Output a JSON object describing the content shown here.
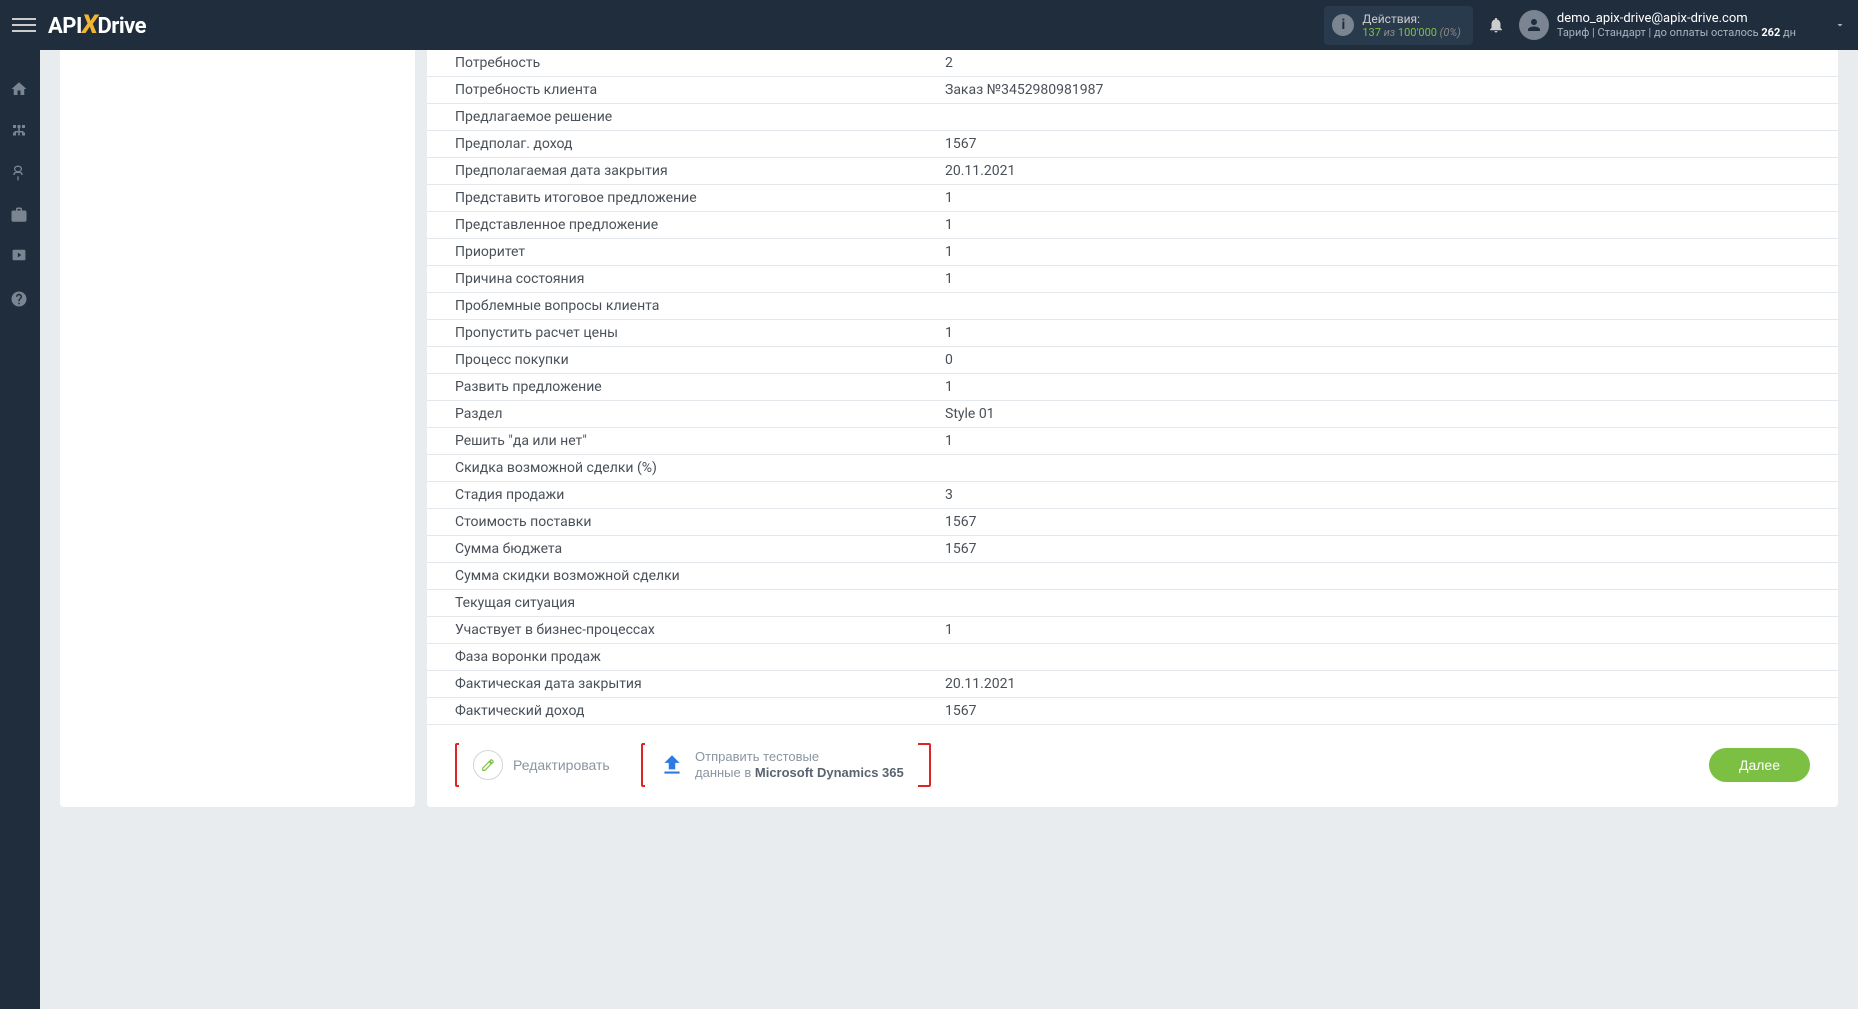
{
  "header": {
    "logo_pre": "API",
    "logo_x": "X",
    "logo_post": "Drive",
    "actions_label": "Действия:",
    "actions_count": "137",
    "actions_of": "из",
    "actions_total": "100'000",
    "actions_pct": "(0%)",
    "user_email": "demo_apix-drive@apix-drive.com",
    "tariff_prefix": "Тариф | Стандарт | до оплаты осталось ",
    "tariff_days": "262",
    "tariff_suffix": " дн"
  },
  "rows": [
    {
      "label": "Потребность",
      "value": "2"
    },
    {
      "label": "Потребность клиента",
      "value": "Заказ №3452980981987"
    },
    {
      "label": "Предлагаемое решение",
      "value": ""
    },
    {
      "label": "Предполаг. доход",
      "value": "1567"
    },
    {
      "label": "Предполагаемая дата закрытия",
      "value": "20.11.2021"
    },
    {
      "label": "Представить итоговое предложение",
      "value": "1"
    },
    {
      "label": "Представленное предложение",
      "value": "1"
    },
    {
      "label": "Приоритет",
      "value": "1"
    },
    {
      "label": "Причина состояния",
      "value": "1"
    },
    {
      "label": "Проблемные вопросы клиента",
      "value": ""
    },
    {
      "label": "Пропустить расчет цены",
      "value": "1"
    },
    {
      "label": "Процесс покупки",
      "value": "0"
    },
    {
      "label": "Развить предложение",
      "value": "1"
    },
    {
      "label": "Раздел",
      "value": "Style 01"
    },
    {
      "label": "Решить \"да или нет\"",
      "value": "1"
    },
    {
      "label": "Скидка возможной сделки (%)",
      "value": ""
    },
    {
      "label": "Стадия продажи",
      "value": "3"
    },
    {
      "label": "Стоимость поставки",
      "value": "1567"
    },
    {
      "label": "Сумма бюджета",
      "value": "1567"
    },
    {
      "label": "Сумма скидки возможной сделки",
      "value": ""
    },
    {
      "label": "Текущая ситуация",
      "value": ""
    },
    {
      "label": "Участвует в бизнес-процессах",
      "value": "1"
    },
    {
      "label": "Фаза воронки продаж",
      "value": ""
    },
    {
      "label": "Фактическая дата закрытия",
      "value": "20.11.2021"
    },
    {
      "label": "Фактический доход",
      "value": "1567"
    }
  ],
  "footer": {
    "edit": "Редактировать",
    "send_line1": "Отправить тестовые",
    "send_line2_pre": "данные в ",
    "send_line2_bold": "Microsoft Dynamics 365",
    "next": "Далее"
  }
}
